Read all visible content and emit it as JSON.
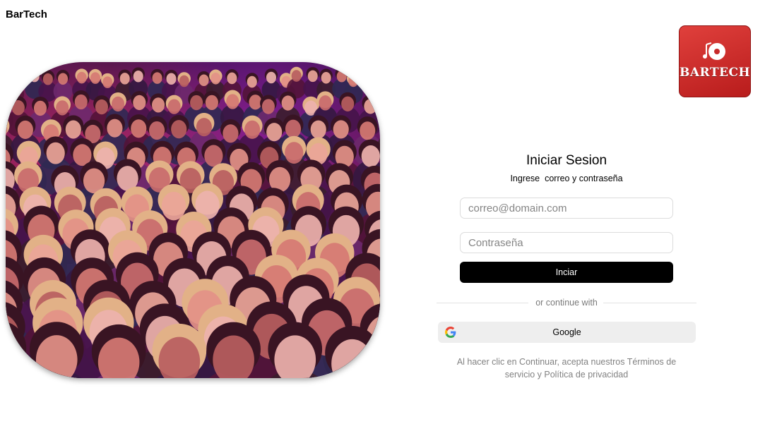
{
  "header": {
    "brand": "BarTech"
  },
  "logo": {
    "text": "BARTECH"
  },
  "login": {
    "title": "Iniciar Sesion",
    "subtitle": "Ingrese  correo y contraseña",
    "email_placeholder": "correo@domain.com",
    "password_placeholder": "Contraseña",
    "submit_label": "Inciar",
    "divider_text": "or continue with",
    "google_label": "Google",
    "terms_text": "Al hacer clic en Continuar, acepta nuestros Términos de servicio y Política de privacidad"
  },
  "colors": {
    "submit_bg": "#000000",
    "google_bg": "#eeeeee",
    "logo_red": "#d32f2f"
  }
}
